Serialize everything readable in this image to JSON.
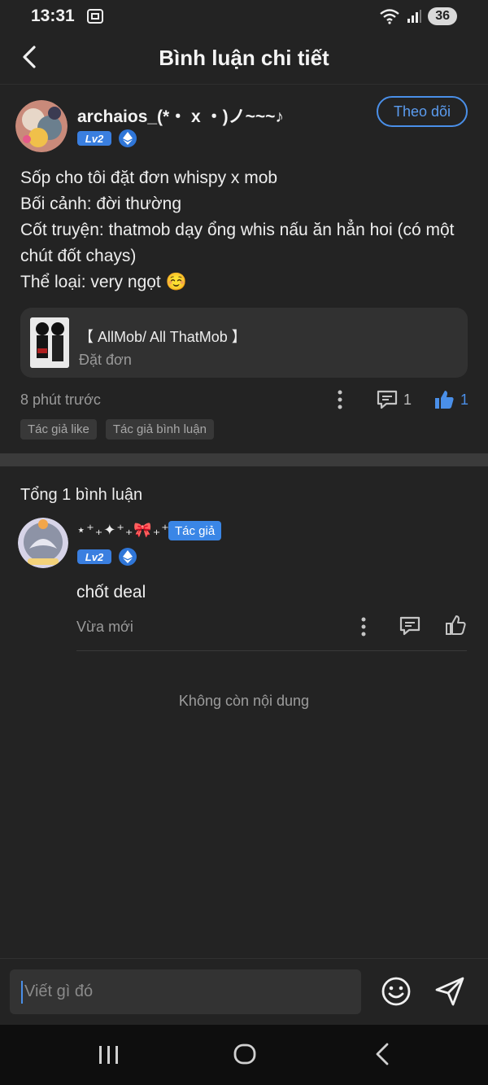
{
  "status_bar": {
    "time": "13:31",
    "battery": "36"
  },
  "header": {
    "title": "Bình luận chi tiết"
  },
  "post": {
    "username": "archaios_(*・ x ・)ノ~~~♪",
    "level": "Lv2",
    "follow_label": "Theo dõi",
    "content_lines": [
      "Sốp cho tôi đặt đơn whispy x mob",
      "Bối cảnh: đời thường",
      "Cốt truyện: thatmob dạy ổng whis nấu ăn hẳn hoi (có một",
      "chút đốt chays)",
      "Thể loại: very ngọt ☺️"
    ],
    "card": {
      "title": "【 AllMob/ All ThatMob 】",
      "subtitle": "Đặt đơn"
    },
    "time": "8 phút trước",
    "comment_count": "1",
    "like_count": "1",
    "tags": [
      "Tác giả like",
      "Tác giả bình luận"
    ]
  },
  "comments_section": {
    "total_label": "Tổng 1 bình luận",
    "comments": [
      {
        "username": "⋆⁺₊✦⁺₊🎀₊⁺✦₊⁺",
        "author_badge": "Tác giả",
        "level": "Lv2",
        "text": "chốt deal",
        "time": "Vừa mới"
      }
    ],
    "end_text": "Không còn nội dung"
  },
  "composer": {
    "placeholder": "Viết gì đó"
  },
  "colors": {
    "accent": "#4a8fe8",
    "background": "#232323",
    "separator": "#3b3b3b"
  }
}
